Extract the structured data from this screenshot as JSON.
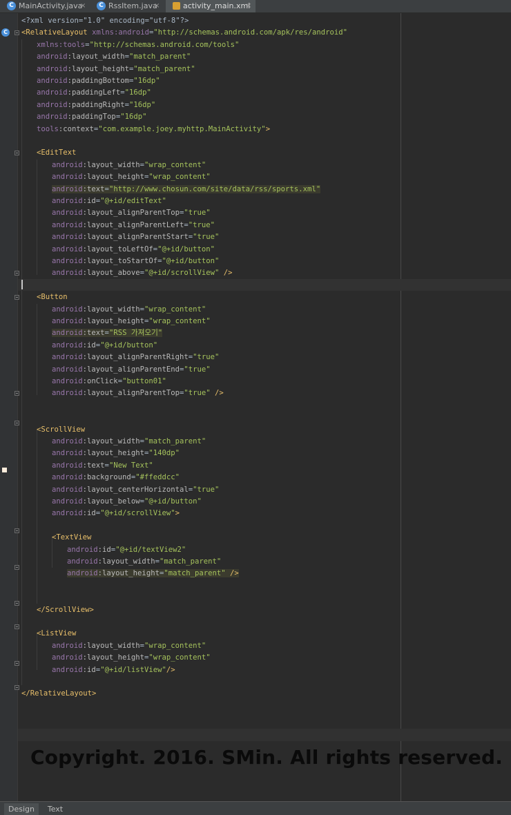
{
  "tabs": [
    {
      "label": "MainActivity.java",
      "icon": "java-class-icon",
      "active": false
    },
    {
      "label": "RssItem.java",
      "icon": "java-class-icon",
      "active": false
    },
    {
      "label": "activity_main.xml",
      "icon": "xml-file-icon",
      "active": true
    }
  ],
  "close_glyph": "×",
  "class_icon_letter": "C",
  "code_lines": [
    {
      "line": 1,
      "parts": [
        [
          "pun",
          "<?xml version=\"1.0\" encoding=\"utf-8\"?>"
        ]
      ]
    },
    {
      "line": 2,
      "parts": [
        [
          "tag",
          "<RelativeLayout "
        ],
        [
          "ans",
          "xmlns:android"
        ],
        [
          "pun",
          "="
        ],
        [
          "val",
          "\"http://schemas.android.com/apk/res/android\""
        ]
      ]
    },
    {
      "line": 3,
      "indent": 1,
      "parts": [
        [
          "ans",
          "xmlns:tools"
        ],
        [
          "pun",
          "="
        ],
        [
          "val",
          "\"http://schemas.android.com/tools\""
        ]
      ]
    },
    {
      "line": 4,
      "indent": 1,
      "parts": [
        [
          "ans",
          "android"
        ],
        [
          "attr",
          ":layout_width"
        ],
        [
          "pun",
          "="
        ],
        [
          "val",
          "\"match_parent\""
        ]
      ]
    },
    {
      "line": 5,
      "indent": 1,
      "parts": [
        [
          "ans",
          "android"
        ],
        [
          "attr",
          ":layout_height"
        ],
        [
          "pun",
          "="
        ],
        [
          "val",
          "\"match_parent\""
        ]
      ]
    },
    {
      "line": 6,
      "indent": 1,
      "parts": [
        [
          "ans",
          "android"
        ],
        [
          "attr",
          ":paddingBottom"
        ],
        [
          "pun",
          "="
        ],
        [
          "val",
          "\"16dp\""
        ]
      ]
    },
    {
      "line": 7,
      "indent": 1,
      "parts": [
        [
          "ans",
          "android"
        ],
        [
          "attr",
          ":paddingLeft"
        ],
        [
          "pun",
          "="
        ],
        [
          "val",
          "\"16dp\""
        ]
      ]
    },
    {
      "line": 8,
      "indent": 1,
      "parts": [
        [
          "ans",
          "android"
        ],
        [
          "attr",
          ":paddingRight"
        ],
        [
          "pun",
          "="
        ],
        [
          "val",
          "\"16dp\""
        ]
      ]
    },
    {
      "line": 9,
      "indent": 1,
      "parts": [
        [
          "ans",
          "android"
        ],
        [
          "attr",
          ":paddingTop"
        ],
        [
          "pun",
          "="
        ],
        [
          "val",
          "\"16dp\""
        ]
      ]
    },
    {
      "line": 10,
      "indent": 1,
      "parts": [
        [
          "ans",
          "tools"
        ],
        [
          "attr",
          ":context"
        ],
        [
          "pun",
          "="
        ],
        [
          "val",
          "\"com.example.joey.myhttp.MainActivity\""
        ],
        [
          "tag",
          ">"
        ]
      ]
    },
    {
      "line": 11,
      "parts": []
    },
    {
      "line": 12,
      "indent": 1,
      "parts": [
        [
          "tag",
          "<EditText"
        ]
      ]
    },
    {
      "line": 13,
      "indent": 2,
      "parts": [
        [
          "ans",
          "android"
        ],
        [
          "attr",
          ":layout_width"
        ],
        [
          "pun",
          "="
        ],
        [
          "val",
          "\"wrap_content\""
        ]
      ]
    },
    {
      "line": 14,
      "indent": 2,
      "parts": [
        [
          "ans",
          "android"
        ],
        [
          "attr",
          ":layout_height"
        ],
        [
          "pun",
          "="
        ],
        [
          "val",
          "\"wrap_content\""
        ]
      ]
    },
    {
      "line": 15,
      "indent": 2,
      "highlight": true,
      "parts": [
        [
          "ans",
          "android"
        ],
        [
          "attr",
          ":text"
        ],
        [
          "pun",
          "="
        ],
        [
          "val",
          "\"http://www.chosun.com/site/data/rss/sports.xml\""
        ]
      ]
    },
    {
      "line": 16,
      "indent": 2,
      "parts": [
        [
          "ans",
          "android"
        ],
        [
          "attr",
          ":id"
        ],
        [
          "pun",
          "="
        ],
        [
          "val",
          "\"@+id/editText\""
        ]
      ]
    },
    {
      "line": 17,
      "indent": 2,
      "parts": [
        [
          "ans",
          "android"
        ],
        [
          "attr",
          ":layout_alignParentTop"
        ],
        [
          "pun",
          "="
        ],
        [
          "val",
          "\"true\""
        ]
      ]
    },
    {
      "line": 18,
      "indent": 2,
      "parts": [
        [
          "ans",
          "android"
        ],
        [
          "attr",
          ":layout_alignParentLeft"
        ],
        [
          "pun",
          "="
        ],
        [
          "val",
          "\"true\""
        ]
      ]
    },
    {
      "line": 19,
      "indent": 2,
      "parts": [
        [
          "ans",
          "android"
        ],
        [
          "attr",
          ":layout_alignParentStart"
        ],
        [
          "pun",
          "="
        ],
        [
          "val",
          "\"true\""
        ]
      ]
    },
    {
      "line": 20,
      "indent": 2,
      "parts": [
        [
          "ans",
          "android"
        ],
        [
          "attr",
          ":layout_toLeftOf"
        ],
        [
          "pun",
          "="
        ],
        [
          "val",
          "\"@+id/button\""
        ]
      ]
    },
    {
      "line": 21,
      "indent": 2,
      "parts": [
        [
          "ans",
          "android"
        ],
        [
          "attr",
          ":layout_toStartOf"
        ],
        [
          "pun",
          "="
        ],
        [
          "val",
          "\"@+id/button\""
        ]
      ]
    },
    {
      "line": 22,
      "indent": 2,
      "parts": [
        [
          "ans",
          "android"
        ],
        [
          "attr",
          ":layout_above"
        ],
        [
          "pun",
          "="
        ],
        [
          "val",
          "\"@+id/scrollView\""
        ],
        [
          "tag",
          " />"
        ]
      ]
    },
    {
      "line": 23,
      "parts": []
    },
    {
      "line": 24,
      "indent": 1,
      "parts": [
        [
          "tag",
          "<Button"
        ]
      ]
    },
    {
      "line": 25,
      "indent": 2,
      "parts": [
        [
          "ans",
          "android"
        ],
        [
          "attr",
          ":layout_width"
        ],
        [
          "pun",
          "="
        ],
        [
          "val",
          "\"wrap_content\""
        ]
      ]
    },
    {
      "line": 26,
      "indent": 2,
      "parts": [
        [
          "ans",
          "android"
        ],
        [
          "attr",
          ":layout_height"
        ],
        [
          "pun",
          "="
        ],
        [
          "val",
          "\"wrap_content\""
        ]
      ]
    },
    {
      "line": 27,
      "indent": 2,
      "highlight": true,
      "parts": [
        [
          "ans",
          "android"
        ],
        [
          "attr",
          ":text"
        ],
        [
          "pun",
          "="
        ],
        [
          "val",
          "\"RSS 가져오기\""
        ]
      ]
    },
    {
      "line": 28,
      "indent": 2,
      "parts": [
        [
          "ans",
          "android"
        ],
        [
          "attr",
          ":id"
        ],
        [
          "pun",
          "="
        ],
        [
          "val",
          "\"@+id/button\""
        ]
      ]
    },
    {
      "line": 29,
      "indent": 2,
      "parts": [
        [
          "ans",
          "android"
        ],
        [
          "attr",
          ":layout_alignParentRight"
        ],
        [
          "pun",
          "="
        ],
        [
          "val",
          "\"true\""
        ]
      ]
    },
    {
      "line": 30,
      "indent": 2,
      "parts": [
        [
          "ans",
          "android"
        ],
        [
          "attr",
          ":layout_alignParentEnd"
        ],
        [
          "pun",
          "="
        ],
        [
          "val",
          "\"true\""
        ]
      ]
    },
    {
      "line": 31,
      "indent": 2,
      "parts": [
        [
          "ans",
          "android"
        ],
        [
          "attr",
          ":onClick"
        ],
        [
          "pun",
          "="
        ],
        [
          "val",
          "\"button01\""
        ]
      ]
    },
    {
      "line": 32,
      "indent": 2,
      "parts": [
        [
          "ans",
          "android"
        ],
        [
          "attr",
          ":layout_alignParentTop"
        ],
        [
          "pun",
          "="
        ],
        [
          "val",
          "\"true\""
        ],
        [
          "tag",
          " />"
        ]
      ]
    },
    {
      "line": 33,
      "parts": []
    },
    {
      "line": 34,
      "parts": []
    },
    {
      "line": 35,
      "indent": 1,
      "parts": [
        [
          "tag",
          "<ScrollView"
        ]
      ]
    },
    {
      "line": 36,
      "indent": 2,
      "parts": [
        [
          "ans",
          "android"
        ],
        [
          "attr",
          ":layout_width"
        ],
        [
          "pun",
          "="
        ],
        [
          "val",
          "\"match_parent\""
        ]
      ]
    },
    {
      "line": 37,
      "indent": 2,
      "parts": [
        [
          "ans",
          "android"
        ],
        [
          "attr",
          ":layout_height"
        ],
        [
          "pun",
          "="
        ],
        [
          "val",
          "\"140dp\""
        ]
      ]
    },
    {
      "line": 38,
      "indent": 2,
      "parts": [
        [
          "ans",
          "android"
        ],
        [
          "attr",
          ":text"
        ],
        [
          "pun",
          "="
        ],
        [
          "val",
          "\"New Text\""
        ]
      ]
    },
    {
      "line": 39,
      "indent": 2,
      "parts": [
        [
          "ans",
          "android"
        ],
        [
          "attr",
          ":background"
        ],
        [
          "pun",
          "="
        ],
        [
          "val",
          "\"#ffeddcc\""
        ]
      ]
    },
    {
      "line": 40,
      "indent": 2,
      "parts": [
        [
          "ans",
          "android"
        ],
        [
          "attr",
          ":layout_centerHorizontal"
        ],
        [
          "pun",
          "="
        ],
        [
          "val",
          "\"true\""
        ]
      ]
    },
    {
      "line": 41,
      "indent": 2,
      "parts": [
        [
          "ans",
          "android"
        ],
        [
          "attr",
          ":layout_below"
        ],
        [
          "pun",
          "="
        ],
        [
          "val",
          "\"@+id/button\""
        ]
      ]
    },
    {
      "line": 42,
      "indent": 2,
      "parts": [
        [
          "ans",
          "android"
        ],
        [
          "attr",
          ":id"
        ],
        [
          "pun",
          "="
        ],
        [
          "val",
          "\"@+id/scrollView\""
        ],
        [
          "tag",
          ">"
        ]
      ]
    },
    {
      "line": 43,
      "parts": []
    },
    {
      "line": 44,
      "indent": 2,
      "parts": [
        [
          "tag",
          "<TextView"
        ]
      ]
    },
    {
      "line": 45,
      "indent": 3,
      "parts": [
        [
          "ans",
          "android"
        ],
        [
          "attr",
          ":id"
        ],
        [
          "pun",
          "="
        ],
        [
          "val",
          "\"@+id/textView2\""
        ]
      ]
    },
    {
      "line": 46,
      "indent": 3,
      "parts": [
        [
          "ans",
          "android"
        ],
        [
          "attr",
          ":layout_width"
        ],
        [
          "pun",
          "="
        ],
        [
          "val",
          "\"match_parent\""
        ]
      ]
    },
    {
      "line": 47,
      "indent": 3,
      "highlight": true,
      "parts": [
        [
          "ans",
          "android"
        ],
        [
          "attr",
          ":layout_height"
        ],
        [
          "pun",
          "="
        ],
        [
          "val",
          "\"match_parent\""
        ],
        [
          "tag",
          " />"
        ]
      ]
    },
    {
      "line": 48,
      "parts": []
    },
    {
      "line": 49,
      "parts": []
    },
    {
      "line": 50,
      "indent": 1,
      "parts": [
        [
          "tag",
          "</ScrollView>"
        ]
      ]
    },
    {
      "line": 51,
      "parts": []
    },
    {
      "line": 52,
      "indent": 1,
      "parts": [
        [
          "tag",
          "<ListView"
        ]
      ]
    },
    {
      "line": 53,
      "indent": 2,
      "parts": [
        [
          "ans",
          "android"
        ],
        [
          "attr",
          ":layout_width"
        ],
        [
          "pun",
          "="
        ],
        [
          "val",
          "\"wrap_content\""
        ]
      ]
    },
    {
      "line": 54,
      "indent": 2,
      "parts": [
        [
          "ans",
          "android"
        ],
        [
          "attr",
          ":layout_height"
        ],
        [
          "pun",
          "="
        ],
        [
          "val",
          "\"wrap_content\""
        ]
      ]
    },
    {
      "line": 55,
      "indent": 2,
      "parts": [
        [
          "ans",
          "android"
        ],
        [
          "attr",
          ":id"
        ],
        [
          "pun",
          "="
        ],
        [
          "val",
          "\"@+id/listView\""
        ],
        [
          "tag",
          "/>"
        ]
      ]
    },
    {
      "line": 56,
      "parts": []
    },
    {
      "line": 57,
      "parts": [
        [
          "tag",
          "</RelativeLayout>"
        ]
      ]
    }
  ],
  "swatch_color": "#ffeddc",
  "watermark": "Copyright. 2016. SMin. All rights reserved.",
  "bottom_tabs": [
    {
      "label": "Design",
      "active": true
    },
    {
      "label": "Text",
      "active": false
    }
  ]
}
